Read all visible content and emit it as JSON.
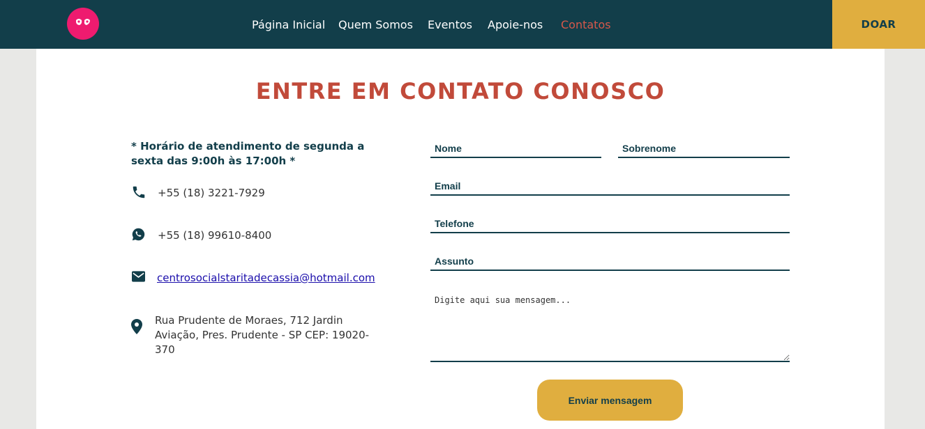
{
  "nav": {
    "items": [
      {
        "label": "Página Inicial"
      },
      {
        "label": "Quem Somos"
      },
      {
        "label": "Eventos"
      },
      {
        "label": "Apoie-nos"
      },
      {
        "label": "Contatos",
        "active": true
      }
    ],
    "donate_label": "DOAR"
  },
  "page": {
    "title": "ENTRE EM CONTATO CONOSCO"
  },
  "info": {
    "hours": "* Horário de atendimento de segunda a sexta das 9:00h às 17:00h *",
    "phone": "+55 (18) 3221-7929",
    "whatsapp": "+55 (18) 99610-8400",
    "email": "centrosocialstaritadecassia@hotmail.com",
    "address": "Rua Prudente de Moraes, 712 Jardin Aviação, Pres. Prudente - SP CEP: 19020-370"
  },
  "form": {
    "first_name_placeholder": "Nome",
    "last_name_placeholder": "Sobrenome",
    "email_placeholder": "Email",
    "phone_placeholder": "Telefone",
    "subject_placeholder": "Assunto",
    "message_placeholder": "Digite aqui sua mensagem...",
    "submit_label": "Enviar mensagem"
  },
  "colors": {
    "header_bg": "#123e4a",
    "accent_gold": "#e0ae3f",
    "title_red": "#c14a3a",
    "active_nav": "#d6584a",
    "logo_pink": "#ee1b6f"
  },
  "icons": [
    "logo-icon",
    "phone-icon",
    "whatsapp-icon",
    "mail-icon",
    "location-pin-icon"
  ]
}
